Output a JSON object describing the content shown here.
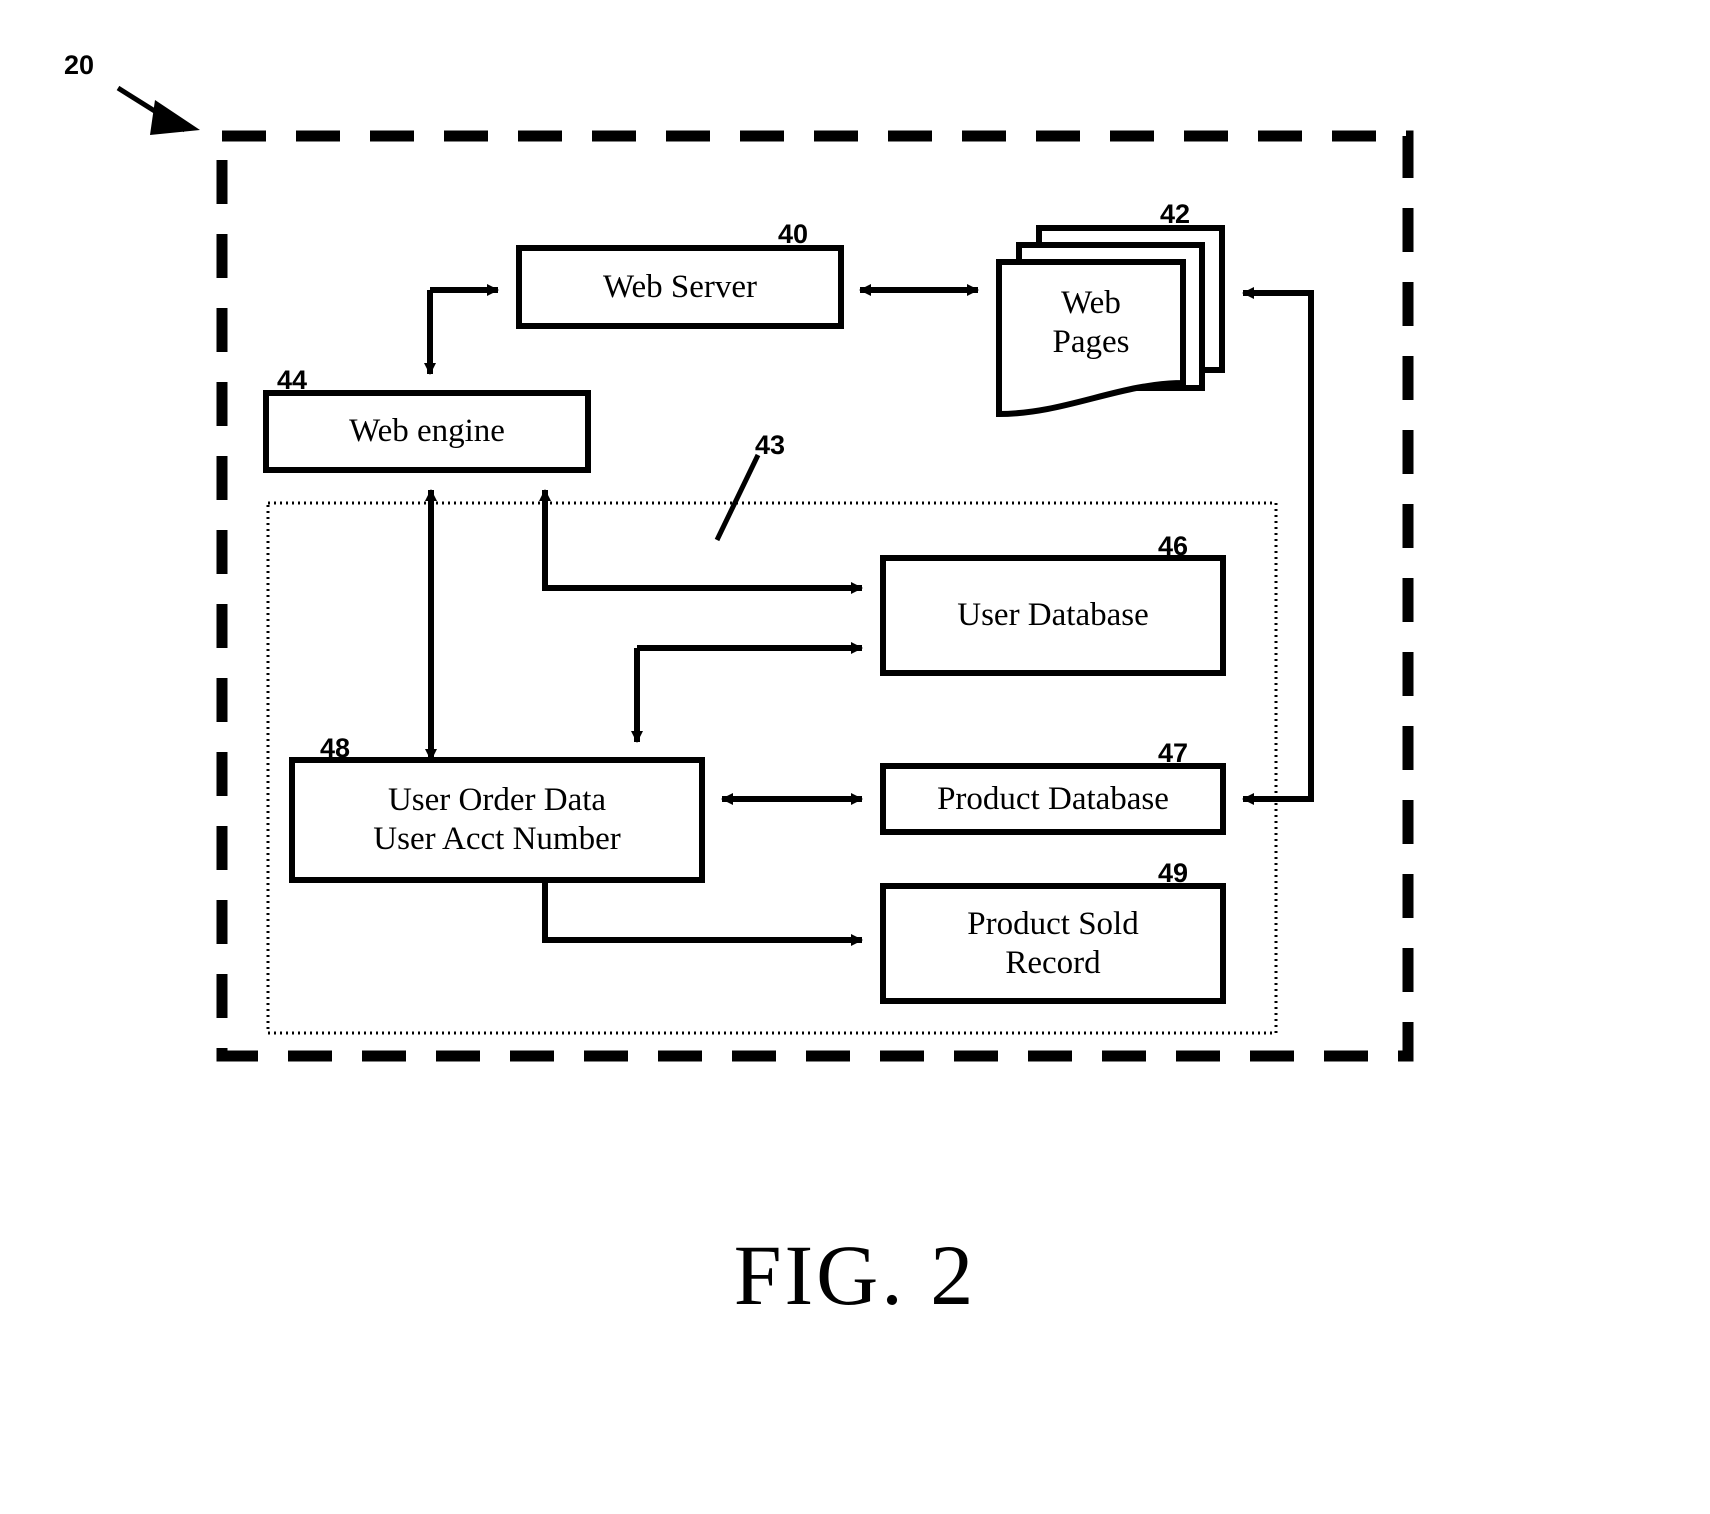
{
  "figure": {
    "caption": "FIG. 2",
    "system_ref": "20",
    "inner_container_ref": "43"
  },
  "nodes": [
    {
      "id": "web-server",
      "label": "Web Server",
      "ref": "40",
      "shape": "rect"
    },
    {
      "id": "web-pages",
      "label": "Web\nPages",
      "ref": "42",
      "shape": "document-stack"
    },
    {
      "id": "web-engine",
      "label": "Web engine",
      "ref": "44",
      "shape": "rect"
    },
    {
      "id": "user-database",
      "label": "User Database",
      "ref": "46",
      "shape": "rect"
    },
    {
      "id": "product-database",
      "label": "Product Database",
      "ref": "47",
      "shape": "rect"
    },
    {
      "id": "user-order-data",
      "label": "User Order Data\nUser Acct Number",
      "ref": "48",
      "shape": "rect"
    },
    {
      "id": "product-sold",
      "label": "Product Sold\nRecord",
      "ref": "49",
      "shape": "rect"
    }
  ],
  "node_text": {
    "web_server": "Web Server",
    "web_pages_line1": "Web",
    "web_pages_line2": "Pages",
    "web_engine": "Web engine",
    "user_database": "User Database",
    "product_database": "Product Database",
    "user_order_line1": "User Order Data",
    "user_order_line2": "User Acct Number",
    "product_sold_line1": "Product Sold",
    "product_sold_line2": "Record"
  },
  "refs": {
    "system": "20",
    "web_server": "40",
    "web_pages": "42",
    "inner_group": "43",
    "web_engine": "44",
    "user_database": "46",
    "product_database": "47",
    "user_order_data": "48",
    "product_sold_record": "49"
  },
  "connections": [
    {
      "from": "web-engine",
      "to": "web-server",
      "direction": "one-way"
    },
    {
      "from": "web-server",
      "to": "web-engine",
      "direction": "one-way"
    },
    {
      "from": "web-server",
      "to": "web-pages",
      "direction": "two-way"
    },
    {
      "from": "web-engine",
      "to": "user-database",
      "direction": "one-way"
    },
    {
      "from": "user-order-data",
      "to": "web-engine",
      "direction": "two-way"
    },
    {
      "from": "user-database",
      "to": "user-order-data",
      "direction": "one-way"
    },
    {
      "from": "user-order-data",
      "to": "product-database",
      "direction": "two-way"
    },
    {
      "from": "user-order-data",
      "to": "product-sold",
      "direction": "one-way"
    },
    {
      "from": "product-database",
      "to": "web-pages",
      "direction": "one-way"
    }
  ],
  "style": {
    "ink": "#000000",
    "paper": "#ffffff"
  }
}
